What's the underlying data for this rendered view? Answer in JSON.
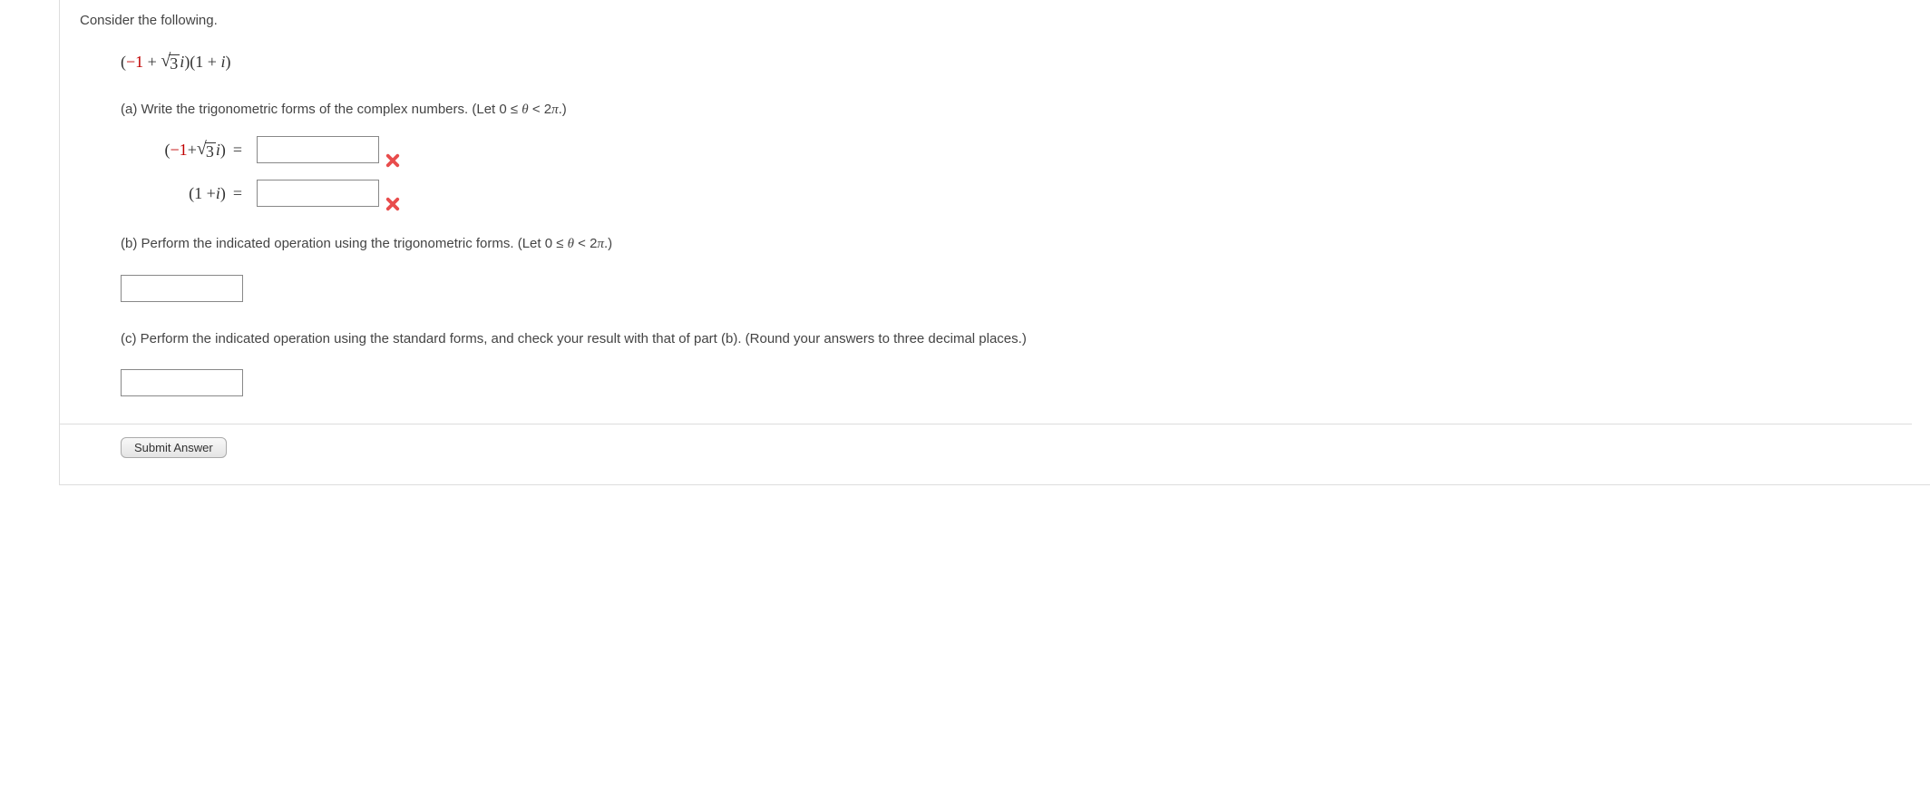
{
  "intro": "Consider the following.",
  "expression": {
    "left_paren": "(",
    "neg1": "−1",
    "plus": " + ",
    "sqrt_body": "3",
    "i": "i",
    "close_first": ")(1 + ",
    "close_second": ")"
  },
  "part_a": {
    "label_prefix": "(a) Write the trigonometric forms of the complex numbers. (Let  0 ≤ ",
    "theta": "θ",
    "label_suffix": " < 2",
    "pi": "π",
    "label_end": ".)",
    "row1_left": {
      "open": "(",
      "neg1": "−1",
      "plus": " + ",
      "sqrt_body": "3",
      "i": "i",
      "close": ")"
    },
    "row2_left": "(1 + i)",
    "equals": "=",
    "wrong_tooltip": "Incorrect"
  },
  "part_b": {
    "label_prefix": "(b) Perform the indicated operation using the trigonometric forms. (Let  0 ≤ ",
    "theta": "θ",
    "label_suffix": " < 2",
    "pi": "π",
    "label_end": ".)"
  },
  "part_c": {
    "text": "(c) Perform the indicated operation using the standard forms, and check your result with that of part (b). (Round your answers to three decimal places.)"
  },
  "submit_label": "Submit Answer"
}
